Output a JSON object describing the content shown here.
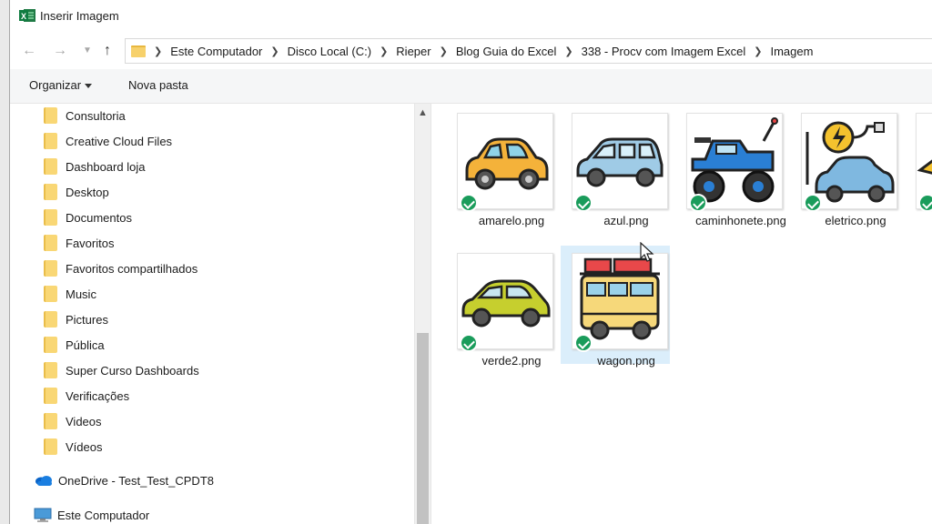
{
  "window": {
    "title": "Inserir Imagem"
  },
  "address": {
    "crumbs": [
      "Este Computador",
      "Disco Local (C:)",
      "Rieper",
      "Blog Guia do Excel",
      "338 - Procv com Imagem Excel",
      "Imagem"
    ]
  },
  "toolbar": {
    "organize_label": "Organizar",
    "new_folder_label": "Nova pasta"
  },
  "nav": {
    "folders": [
      "Consultoria",
      "Creative Cloud Files",
      "Dashboard loja",
      "Desktop",
      "Documentos",
      "Favoritos",
      "Favoritos compartilhados",
      "Music",
      "Pictures",
      "Pública",
      "Super Curso Dashboards",
      "Verificações",
      "Videos",
      "Vídeos"
    ],
    "onedrive_label": "OneDrive - Test_Test_CPDT8",
    "this_pc_label": "Este Computador"
  },
  "files": [
    {
      "name": "amarelo.png",
      "icon": "yellow-car"
    },
    {
      "name": "azul.png",
      "icon": "blue-car"
    },
    {
      "name": "caminhonete.png",
      "icon": "monster-truck"
    },
    {
      "name": "eletrico.png",
      "icon": "electric-car"
    },
    {
      "name": "e",
      "icon": "partial-thumbnail"
    },
    {
      "name": "verde2.png",
      "icon": "green-car"
    },
    {
      "name": "wagon.png",
      "icon": "wagon-van"
    }
  ],
  "colors": {
    "selection": "#dbeefb",
    "sync_check": "#1a9c5b",
    "folder": "#f9d775"
  }
}
